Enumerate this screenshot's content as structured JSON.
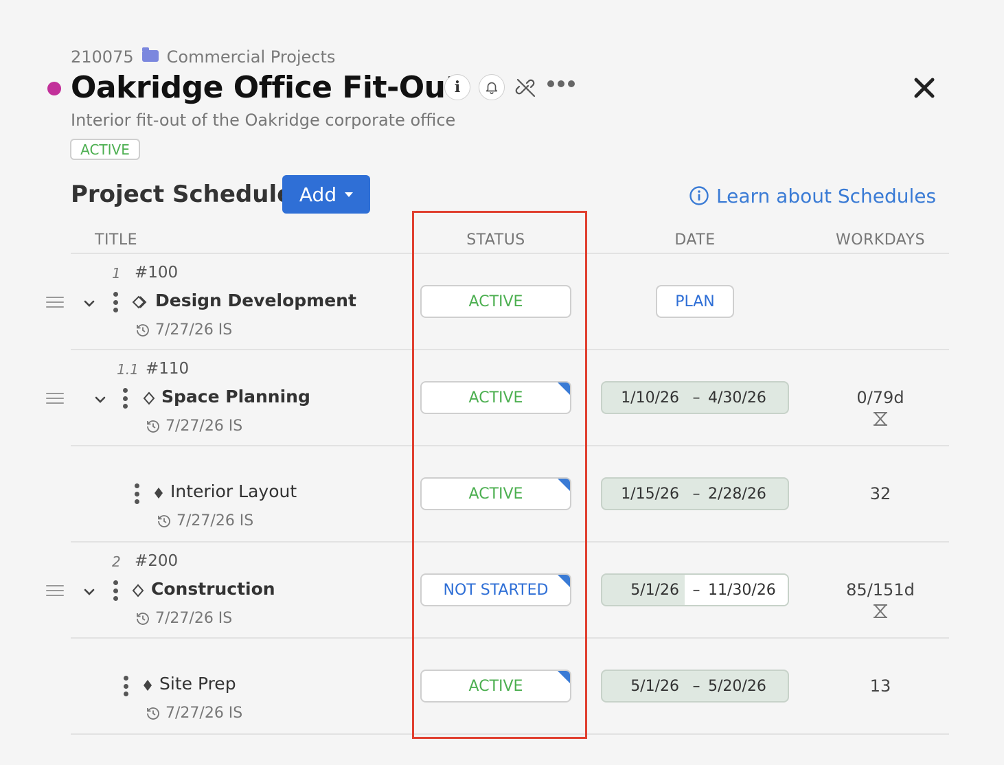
{
  "header": {
    "project_number": "210075",
    "folder_name": "Commercial Projects",
    "title": "Oakridge Office Fit-Out",
    "subtitle": "Interior fit-out of the Oakridge corporate office",
    "status": "ACTIVE",
    "status_color": "#4caf50",
    "dot_color": "#c2309a",
    "icons": [
      "folder-icon",
      "info-icon",
      "bell-icon",
      "unlink-icon",
      "more-icon",
      "close-icon"
    ]
  },
  "schedule": {
    "title": "Project Schedule",
    "add_label": "Add",
    "learn_link": "Learn about Schedules",
    "columns": {
      "title": "TITLE",
      "status": "STATUS",
      "date": "DATE",
      "workdays": "WORKDAYS"
    }
  },
  "rows": [
    {
      "num": "1",
      "ref": "#100",
      "title": "Design Development",
      "meta": "7/27/26 IS",
      "status": "ACTIVE",
      "date_label": "PLAN",
      "workdays": ""
    },
    {
      "num": "1.1",
      "ref": "#110",
      "title": "Space Planning",
      "meta": "7/27/26 IS",
      "status": "ACTIVE",
      "date_start": "1/10/26",
      "date_end": "4/30/26",
      "workdays": "0/79d"
    },
    {
      "num": "",
      "ref": "",
      "title": "Interior Layout",
      "meta": "7/27/26 IS",
      "status": "ACTIVE",
      "date_start": "1/15/26",
      "date_end": "2/28/26",
      "workdays": "32"
    },
    {
      "num": "2",
      "ref": "#200",
      "title": "Construction",
      "meta": "7/27/26 IS",
      "status": "NOT STARTED",
      "date_start": "5/1/26",
      "date_end": "11/30/26",
      "workdays": "85/151d"
    },
    {
      "num": "",
      "ref": "",
      "title": "Site Prep",
      "meta": "7/27/26 IS",
      "status": "ACTIVE",
      "date_start": "5/1/26",
      "date_end": "5/20/26",
      "workdays": "13"
    }
  ],
  "date_separator": "–",
  "colors": {
    "active": "#4caf50",
    "not_started": "#2f6fd6",
    "link": "#3a7bd5",
    "highlight": "#e04030"
  }
}
